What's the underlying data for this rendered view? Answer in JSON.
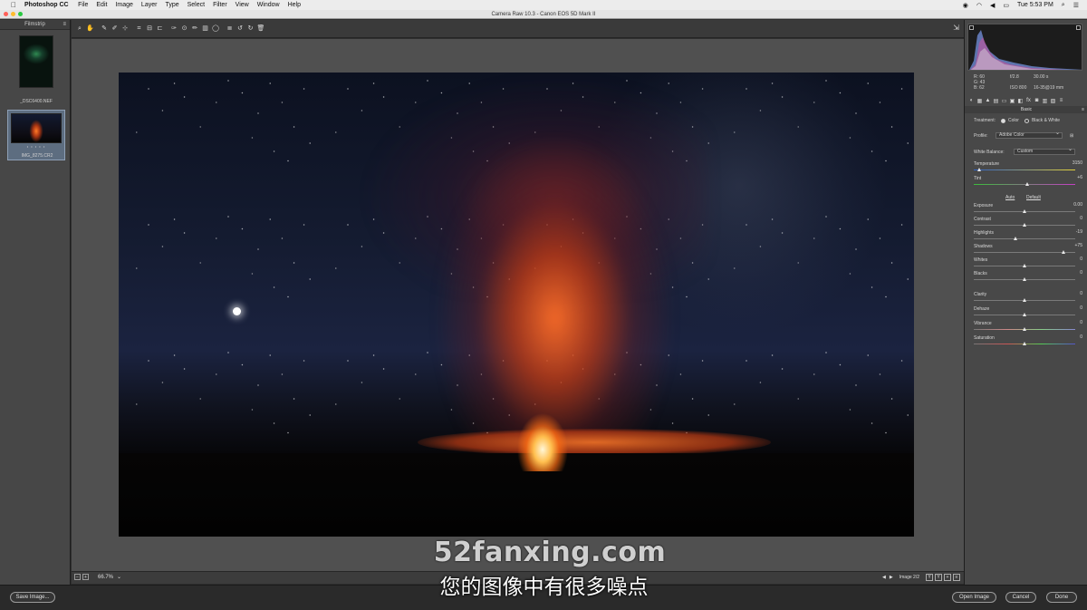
{
  "menubar": {
    "app": "Photoshop CC",
    "items": [
      "File",
      "Edit",
      "Image",
      "Layer",
      "Type",
      "Select",
      "Filter",
      "View",
      "Window",
      "Help"
    ],
    "clock": "Tue 5:53 PM"
  },
  "window": {
    "title": "Camera Raw 10.3  -  Canon EOS 5D Mark II"
  },
  "filmstrip": {
    "title": "Filmstrip",
    "items": [
      {
        "name": "_DSC6400.NEF",
        "selected": false
      },
      {
        "name": "IMG_8275.CR2",
        "selected": true,
        "rating": "• • • • •"
      }
    ]
  },
  "toolbar": {
    "tools": [
      "zoom-icon",
      "hand-icon",
      "white-balance-icon",
      "color-sampler-icon",
      "targeted-adjustment-icon",
      "crop-icon",
      "straighten-icon",
      "transform-icon",
      "spot-removal-icon",
      "red-eye-icon",
      "adjustment-brush-icon",
      "graduated-filter-icon",
      "radial-filter-icon",
      "preferences-icon",
      "rotate-left-icon",
      "rotate-right-icon",
      "trash-icon"
    ],
    "export_icon": "export-icon"
  },
  "preview": {
    "zoom": "66.7%",
    "image_counter": "Image 2/2",
    "view_buttons": [
      "Y",
      "Y",
      "+",
      "≡"
    ]
  },
  "readout": {
    "r": "R:  60",
    "g": "G:  43",
    "b": "B:  62",
    "aperture": "f/2.8",
    "shutter": "30.00 s",
    "iso": "ISO 800",
    "lens": "16-35@19 mm"
  },
  "panel": {
    "section": "Basic",
    "treatment_label": "Treatment:",
    "treatment_color": "Color",
    "treatment_bw": "Black & White",
    "profile_label": "Profile:",
    "profile_value": "Adobe Color",
    "wb_label": "White Balance:",
    "wb_value": "Custom",
    "auto": "Auto",
    "default": "Default",
    "sliders": [
      {
        "label": "Temperature",
        "value": "3150",
        "pos": 0.05
      },
      {
        "label": "Tint",
        "value": "+6",
        "pos": 0.53
      },
      {
        "label": "Exposure",
        "value": "0.00",
        "pos": 0.5
      },
      {
        "label": "Contrast",
        "value": "0",
        "pos": 0.5
      },
      {
        "label": "Highlights",
        "value": "-19",
        "pos": 0.41
      },
      {
        "label": "Shadows",
        "value": "+75",
        "pos": 0.88
      },
      {
        "label": "Whites",
        "value": "0",
        "pos": 0.5
      },
      {
        "label": "Blacks",
        "value": "0",
        "pos": 0.5
      },
      {
        "label": "Clarity",
        "value": "0",
        "pos": 0.5
      },
      {
        "label": "Dehaze",
        "value": "0",
        "pos": 0.5
      },
      {
        "label": "Vibrance",
        "value": "0",
        "pos": 0.5
      },
      {
        "label": "Saturation",
        "value": "0",
        "pos": 0.5
      }
    ]
  },
  "footer": {
    "save": "Save Image...",
    "open": "Open Image",
    "cancel": "Cancel",
    "done": "Done"
  },
  "overlay": {
    "watermark": "52fanxing.com",
    "subtitle": "您的图像中有很多噪点"
  }
}
